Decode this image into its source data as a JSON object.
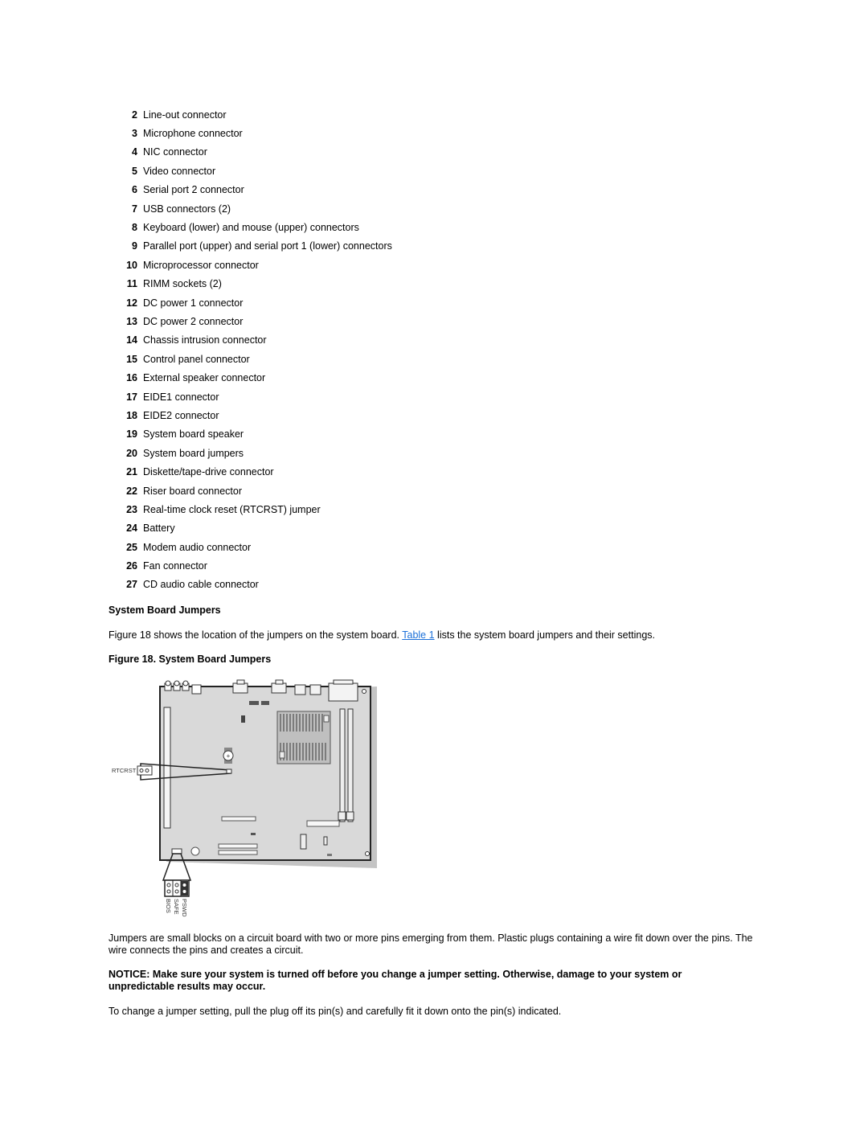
{
  "legend": [
    {
      "num": "2",
      "text": "Line-out connector"
    },
    {
      "num": "3",
      "text": "Microphone connector"
    },
    {
      "num": "4",
      "text": "NIC connector"
    },
    {
      "num": "5",
      "text": "Video connector"
    },
    {
      "num": "6",
      "text": "Serial port 2 connector"
    },
    {
      "num": "7",
      "text": "USB connectors (2)"
    },
    {
      "num": "8",
      "text": "Keyboard (lower) and mouse (upper) connectors"
    },
    {
      "num": "9",
      "text": "Parallel port (upper) and serial port 1 (lower) connectors"
    },
    {
      "num": "10",
      "text": "Microprocessor connector"
    },
    {
      "num": "11",
      "text": "RIMM sockets (2)"
    },
    {
      "num": "12",
      "text": "DC power 1 connector"
    },
    {
      "num": "13",
      "text": "DC power 2 connector"
    },
    {
      "num": "14",
      "text": "Chassis intrusion connector"
    },
    {
      "num": "15",
      "text": "Control panel connector"
    },
    {
      "num": "16",
      "text": "External speaker connector"
    },
    {
      "num": "17",
      "text": "EIDE1 connector"
    },
    {
      "num": "18",
      "text": "EIDE2 connector"
    },
    {
      "num": "19",
      "text": "System board speaker"
    },
    {
      "num": "20",
      "text": "System board jumpers"
    },
    {
      "num": "21",
      "text": "Diskette/tape-drive connector"
    },
    {
      "num": "22",
      "text": "Riser board connector"
    },
    {
      "num": "23",
      "text": "Real-time clock reset (RTCRST) jumper"
    },
    {
      "num": "24",
      "text": "Battery"
    },
    {
      "num": "25",
      "text": "Modem audio connector"
    },
    {
      "num": "26",
      "text": "Fan connector"
    },
    {
      "num": "27",
      "text": "CD audio cable connector"
    }
  ],
  "section": {
    "heading": "System Board Jumpers",
    "intro_before_link": "Figure 18 shows the location of the jumpers on the system board. ",
    "link_text": "Table 1",
    "intro_after_link": " lists the system board jumpers and their settings.",
    "figure_caption": "Figure 18. System Board Jumpers",
    "figure_labels": {
      "rtcrst": "RTCRST",
      "bios": "BIOS",
      "safe": "SAFE",
      "pswd": "PSWD"
    },
    "jumpers_paragraph": "Jumpers are small blocks on a circuit board with two or more pins emerging from them. Plastic plugs containing a wire fit down over the pins. The wire connects the pins and creates a circuit.",
    "notice": "NOTICE: Make sure your system is turned off before you change a jumper setting. Otherwise, damage to your system or unpredictable results may occur.",
    "change_paragraph": "To change a jumper setting, pull the plug off its pin(s) and carefully fit it down onto the pin(s) indicated."
  },
  "colors": {
    "link": "#1a6fd8",
    "board_fill": "#d8d8d8",
    "board_shadow": "#bdbdbd"
  }
}
